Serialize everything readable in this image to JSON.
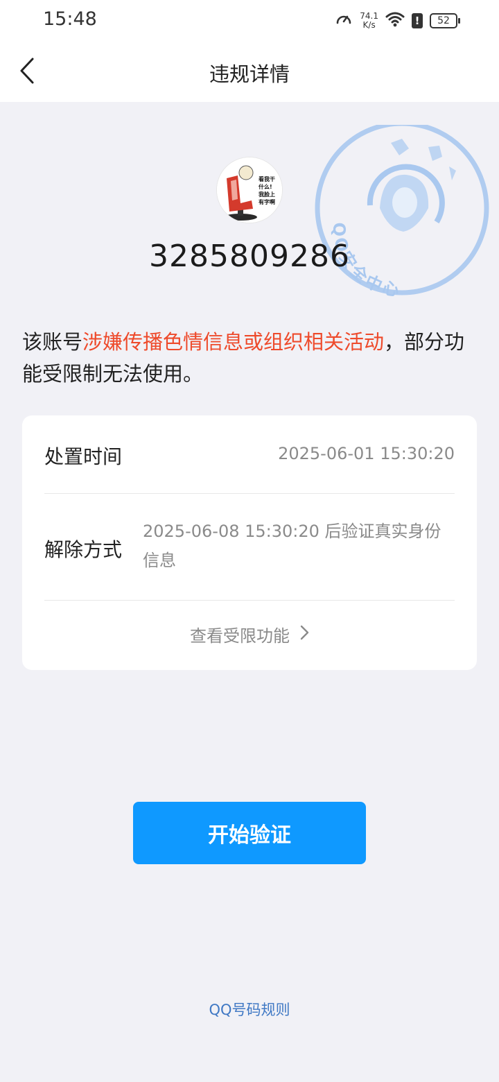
{
  "status_bar": {
    "time": "15:48",
    "net_speed_value": "74.1",
    "net_speed_unit": "K/s",
    "battery": "52",
    "icons": [
      "speedometer-icon",
      "wifi-icon",
      "alert-icon",
      "battery-icon"
    ]
  },
  "nav": {
    "title": "违规详情",
    "back_icon": "chevron-left-icon"
  },
  "account": {
    "number": "3285809286",
    "avatar_text": [
      "看我干",
      "什么!",
      "我脸上",
      "有字啊"
    ]
  },
  "stamp": {
    "text": "QQ安全中心"
  },
  "notice": {
    "prefix": "该账号",
    "reason": "涉嫌传播色情信息或组织相关活动",
    "suffix": "，部分功能受限制无法使用。",
    "reason_color": "#ee4a2b"
  },
  "details": {
    "disposal_time_label": "处置时间",
    "disposal_time_value": "2025-06-01 15:30:20",
    "unlock_method_label": "解除方式",
    "unlock_method_value": "2025-06-08 15:30:20 后验证真实身份信息",
    "restricted_link": "查看受限功能"
  },
  "actions": {
    "start_verify": "开始验证",
    "rules_link": "QQ号码规则",
    "accent_color": "#0f99ff"
  }
}
